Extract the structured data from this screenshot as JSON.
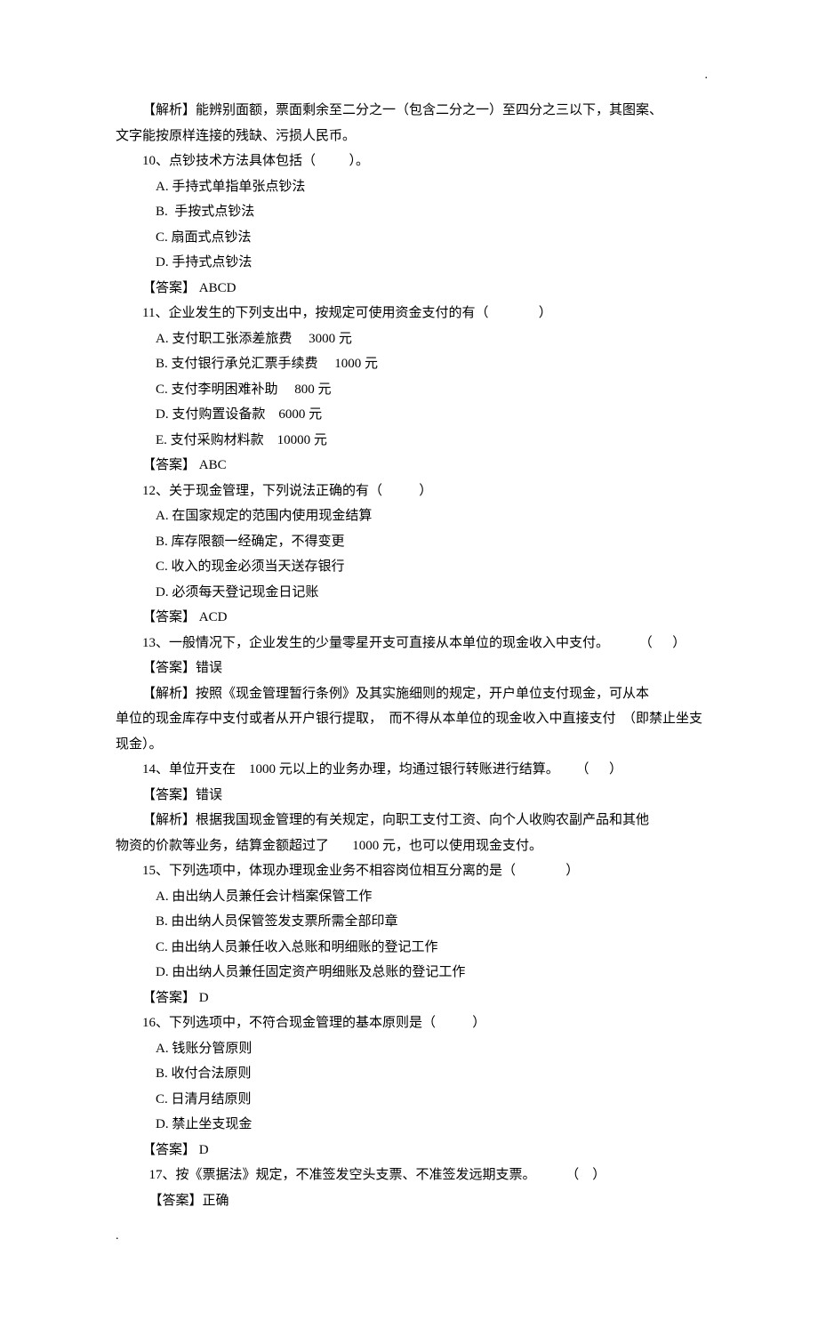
{
  "cornerDot": ".",
  "bottomDot": ".",
  "lines": [
    {
      "cls": "indent1",
      "text": "【解析】能辨别面额，票面剩余至二分之一（包含二分之一）至四分之三以下，其图案、"
    },
    {
      "cls": "",
      "text": "文字能按原样连接的残缺、污损人民币。"
    },
    {
      "cls": "indent1",
      "text": "10、点钞技术方法具体包括（          ）。"
    },
    {
      "cls": "indent2",
      "text": "A. 手持式单指单张点钞法"
    },
    {
      "cls": "indent2",
      "text": "B.  手按式点钞法"
    },
    {
      "cls": "indent2",
      "text": "C. 扇面式点钞法"
    },
    {
      "cls": "indent2",
      "text": "D. 手持式点钞法"
    },
    {
      "cls": "indent1",
      "text": "【答案】 ABCD"
    },
    {
      "cls": "indent1",
      "text": "11、企业发生的下列支出中，按规定可使用资金支付的有（               ）"
    },
    {
      "cls": "indent2",
      "text": "A. 支付职工张添差旅费     3000 元"
    },
    {
      "cls": "indent2",
      "text": "B. 支付银行承兑汇票手续费     1000 元"
    },
    {
      "cls": "indent2",
      "text": "C. 支付李明困难补助     800 元"
    },
    {
      "cls": "indent2",
      "text": "D. 支付购置设备款    6000 元"
    },
    {
      "cls": "indent2",
      "text": "E. 支付采购材料款    10000 元"
    },
    {
      "cls": "indent1",
      "text": "【答案】 ABC"
    },
    {
      "cls": "indent1",
      "text": "12、关于现金管理，下列说法正确的有（           ）"
    },
    {
      "cls": "indent2",
      "text": "A. 在国家规定的范围内使用现金结算"
    },
    {
      "cls": "indent2",
      "text": "B. 库存限额一经确定，不得变更"
    },
    {
      "cls": "indent2",
      "text": "C. 收入的现金必须当天送存银行"
    },
    {
      "cls": "indent2",
      "text": "D. 必须每天登记现金日记账"
    },
    {
      "cls": "indent1",
      "text": "【答案】 ACD"
    },
    {
      "cls": "indent1",
      "text": "13、一般情况下，企业发生的少量零星开支可直接从本单位的现金收入中支付。         （      ）"
    },
    {
      "cls": "indent1",
      "text": "【答案】错误"
    },
    {
      "cls": "indent1",
      "text": "【解析】按照《现金管理暂行条例》及其实施细则的规定，开户单位支付现金，可从本"
    },
    {
      "cls": "",
      "text": "单位的现金库存中支付或者从开户银行提取，  而不得从本单位的现金收入中直接支付  （即禁止坐支"
    },
    {
      "cls": "",
      "text": "现金）。"
    },
    {
      "cls": "indent1",
      "text": "14、单位开支在    1000 元以上的业务办理，均通过银行转账进行结算。     （      ）"
    },
    {
      "cls": "indent1",
      "text": "【答案】错误"
    },
    {
      "cls": "indent1",
      "text": "【解析】根据我国现金管理的有关规定，向职工支付工资、向个人收购农副产品和其他"
    },
    {
      "cls": "",
      "text": "物资的价款等业务，结算金额超过了       1000 元，也可以使用现金支付。"
    },
    {
      "cls": "indent1",
      "text": "15、下列选项中，体现办理现金业务不相容岗位相互分离的是（               ）"
    },
    {
      "cls": "indent2",
      "text": "A. 由出纳人员兼任会计档案保管工作"
    },
    {
      "cls": "indent2",
      "text": "B. 由出纳人员保管签发支票所需全部印章"
    },
    {
      "cls": "indent2",
      "text": "C. 由出纳人员兼任收入总账和明细账的登记工作"
    },
    {
      "cls": "indent2",
      "text": "D. 由出纳人员兼任固定资产明细账及总账的登记工作"
    },
    {
      "cls": "indent1",
      "text": "【答案】 D"
    },
    {
      "cls": "indent1",
      "text": "16、下列选项中，不符合现金管理的基本原则是（           ）"
    },
    {
      "cls": "indent2",
      "text": "A. 钱账分管原则"
    },
    {
      "cls": "indent2",
      "text": "B. 收付合法原则"
    },
    {
      "cls": "indent2",
      "text": "C. 日清月结原则"
    },
    {
      "cls": "indent2",
      "text": "D. 禁止坐支现金"
    },
    {
      "cls": "indent1",
      "text": "【答案】 D"
    },
    {
      "cls": "indent1-5",
      "text": "17、按《票据法》规定，不准签发空头支票、不准签发远期支票。         （    ）"
    },
    {
      "cls": "indent1-5",
      "text": "【答案】正确"
    }
  ]
}
